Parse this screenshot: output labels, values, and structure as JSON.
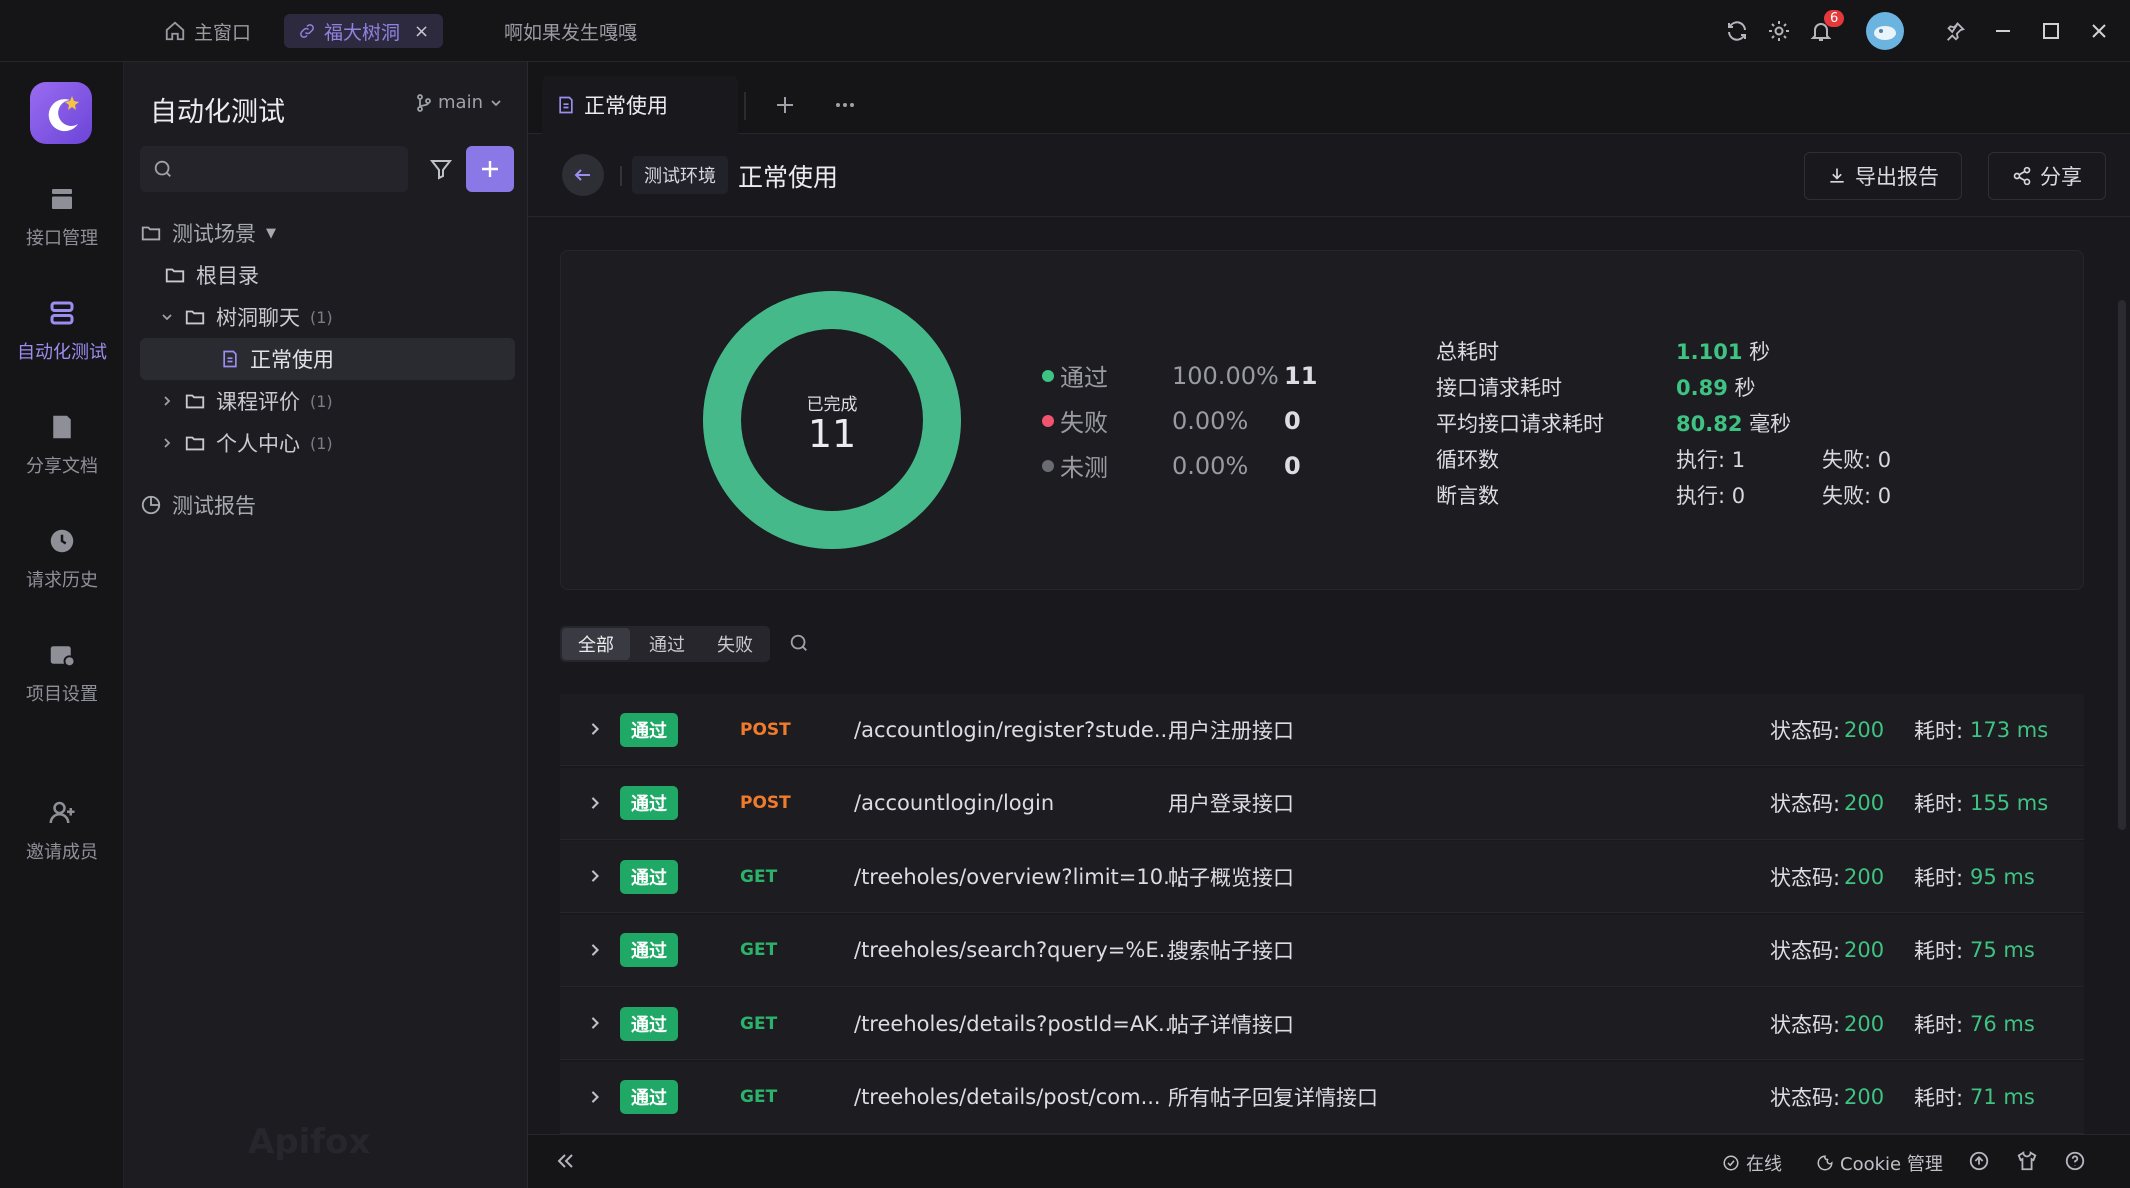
{
  "window": {
    "tabs": [
      {
        "label": "主窗口"
      },
      {
        "label": "福大树洞"
      },
      {
        "label": "啊如果发生嘎嘎"
      }
    ],
    "notifications_count": "6"
  },
  "rail": {
    "items": [
      {
        "label": "接口管理"
      },
      {
        "label": "自动化测试"
      },
      {
        "label": "分享文档"
      },
      {
        "label": "请求历史"
      },
      {
        "label": "项目设置"
      },
      {
        "label": "邀请成员"
      }
    ]
  },
  "tree": {
    "title": "自动化测试",
    "branch": "main",
    "search_placeholder": "",
    "section_scenes": "测试场景",
    "root": "根目录",
    "folder1": {
      "label": "树洞聊天",
      "count": "(1)"
    },
    "scenario": "正常使用",
    "folder2": {
      "label": "课程评价",
      "count": "(1)"
    },
    "folder3": {
      "label": "个人中心",
      "count": "(1)"
    },
    "reports": "测试报告",
    "watermark": "Apifox"
  },
  "main": {
    "tab_label": "正常使用",
    "env_label": "测试环境",
    "page_title": "正常使用",
    "export_label": "导出报告",
    "share_label": "分享",
    "donut": {
      "caption": "已完成",
      "total": "11",
      "pass_fraction": 1.0
    },
    "legend": [
      {
        "label": "通过",
        "percent": "100.00%",
        "count": "11",
        "color": "#3fc382"
      },
      {
        "label": "失败",
        "percent": "0.00%",
        "count": "0",
        "color": "#f0546e"
      },
      {
        "label": "未测",
        "percent": "0.00%",
        "count": "0",
        "color": "#6b6b73"
      }
    ],
    "stats": {
      "total_time_label": "总耗时",
      "total_time_value": "1.101",
      "total_time_unit": "秒",
      "req_time_label": "接口请求耗时",
      "req_time_value": "0.89",
      "req_time_unit": "秒",
      "avg_time_label": "平均接口请求耗时",
      "avg_time_value": "80.82",
      "avg_time_unit": "毫秒",
      "loops_label": "循环数",
      "loops_exec": "执行: 1",
      "loops_fail": "失败: 0",
      "asserts_label": "断言数",
      "asserts_exec": "执行: 0",
      "asserts_fail": "失败: 0"
    },
    "filter_tabs": [
      "全部",
      "通过",
      "失败"
    ],
    "status_code_label": "状态码:",
    "time_label": "耗时:",
    "rows": [
      {
        "status": "通过",
        "method": "POST",
        "path": "/accountlogin/register?stude...",
        "name": "用户注册接口",
        "code": "200",
        "time": "173 ms"
      },
      {
        "status": "通过",
        "method": "POST",
        "path": "/accountlogin/login",
        "name": "用户登录接口",
        "code": "200",
        "time": "155 ms"
      },
      {
        "status": "通过",
        "method": "GET",
        "path": "/treeholes/overview?limit=10...",
        "name": "帖子概览接口",
        "code": "200",
        "time": "95 ms"
      },
      {
        "status": "通过",
        "method": "GET",
        "path": "/treeholes/search?query=%E...",
        "name": "搜索帖子接口",
        "code": "200",
        "time": "75 ms"
      },
      {
        "status": "通过",
        "method": "GET",
        "path": "/treeholes/details?postId=AK...",
        "name": "帖子详情接口",
        "code": "200",
        "time": "76 ms"
      },
      {
        "status": "通过",
        "method": "GET",
        "path": "/treeholes/details/post/com...",
        "name": "所有帖子回复详情接口",
        "code": "200",
        "time": "71 ms"
      }
    ]
  },
  "footer": {
    "online": "在线",
    "cookie": "Cookie 管理"
  },
  "colors": {
    "accent": "#8f83e0",
    "pass": "#3fc382",
    "post": "#f07b2d",
    "get": "#2cb36b"
  }
}
